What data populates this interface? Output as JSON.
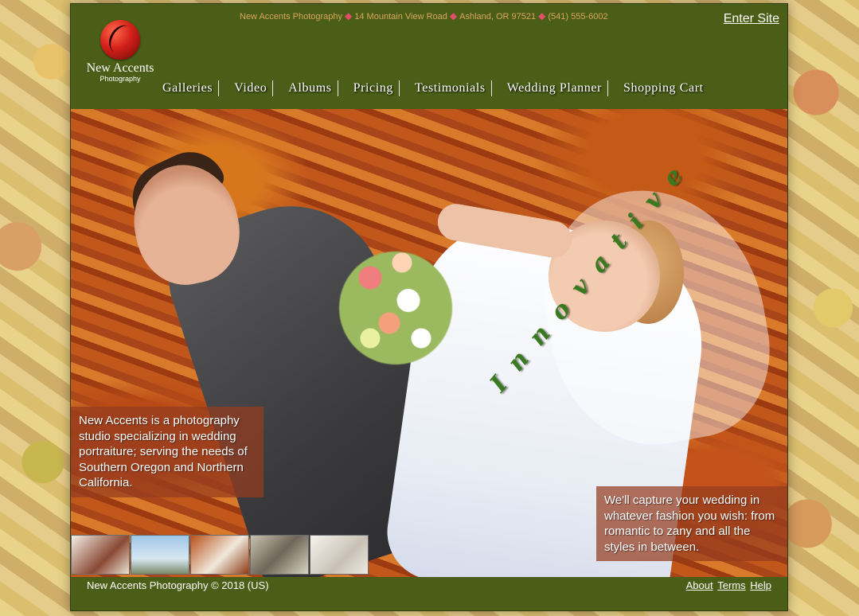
{
  "header": {
    "logo": {
      "name": "New Accents",
      "sub": "Photography"
    },
    "contact": {
      "studio": "New Accents Photography",
      "address": "14 Mountain View Road",
      "city": "Ashland, OR 97521",
      "phone": "(541) 555-6002",
      "separator": "◆"
    },
    "enter_site": "Enter Site"
  },
  "nav": {
    "items": [
      "Galleries",
      "Video",
      "Albums",
      "Pricing",
      "Testimonials",
      "Wedding Planner",
      "Shopping Cart"
    ]
  },
  "hero": {
    "script_text": "Innovative",
    "caption_left": "New Accents is a photography studio specializing in wedding portraiture; serving the needs of Southern Oregon and Northern California.",
    "caption_right": "We'll capture your wedding in whatever fashion you wish: from romantic to zany and all the styles in between."
  },
  "footer": {
    "copyright": "New Accents Photography © 2018 (US)",
    "links": [
      "About",
      "Terms",
      "Help"
    ]
  },
  "colors": {
    "frame_green": "#4a5e17",
    "contact_text": "#d9a55c",
    "diamond": "#e24d6a",
    "script_green": "#3a7a1f"
  }
}
